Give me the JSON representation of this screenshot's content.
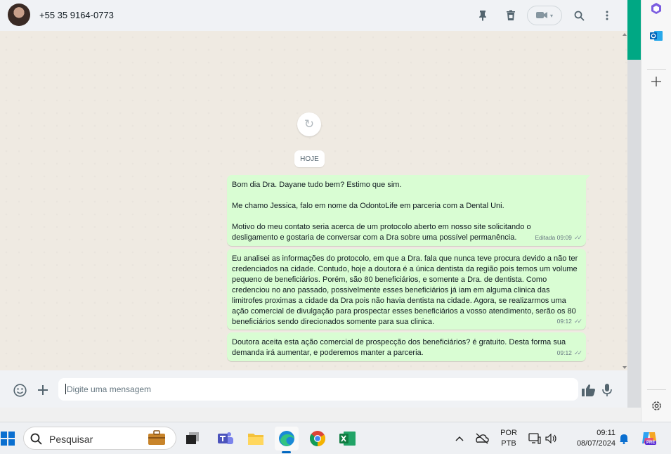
{
  "header": {
    "contact_name": "+55 35 9164-0773",
    "icons": [
      "pin-icon",
      "delete-icon",
      "video-call-icon",
      "search-icon",
      "menu-icon"
    ]
  },
  "chat": {
    "date_label": "HOJE",
    "messages": [
      {
        "paragraphs": [
          "Bom dia Dra. Dayane tudo bem? Estimo que sim.",
          "Me chamo Jessica, falo em nome da OdontoLife em parceria com a Dental Uni.",
          "Motivo do meu contato seria acerca de um protocolo aberto em nosso site solicitando o desligamento e gostaria de conversar com a Dra sobre uma possível permanência."
        ],
        "meta": "Editada 09:09"
      },
      {
        "paragraphs": [
          "Eu analisei as informações do protocolo, em que a Dra. fala que nunca teve procura devido a não ter credenciados na cidade. Contudo, hoje a doutora é a única dentista da região pois temos um volume pequeno de beneficiários. Porém, são 80 beneficiários, e somente a Dra. de dentista. Como credenciou no ano passado, possivelmente esses beneficiários já iam em alguma clinica das limitrofes proximas a cidade da Dra pois não havia dentista na cidade. Agora, se realizarmos uma ação comercial de divulgação para prospectar esses beneficiários a vosso atendimento, serão os 80 beneficiários sendo direcionados somente para sua clinica."
        ],
        "meta": "09:12"
      },
      {
        "paragraphs": [
          "Doutora aceita esta ação comercial de prospecção dos beneficiários? é gratuito. Desta forma sua demanda irá aumentar, e poderemos manter a parceria."
        ],
        "meta": "09:12"
      }
    ]
  },
  "composer": {
    "placeholder": "Digite uma mensagem"
  },
  "taskbar": {
    "search_label": "Pesquisar",
    "language_top": "POR",
    "language_bottom": "PTB",
    "time": "09:11",
    "date": "08/07/2024",
    "copilot_badge": "PRE"
  },
  "colors": {
    "outgoing_bubble": "#d9fdd3",
    "accent_green": "#00a884",
    "chat_background": "#efeae2"
  }
}
